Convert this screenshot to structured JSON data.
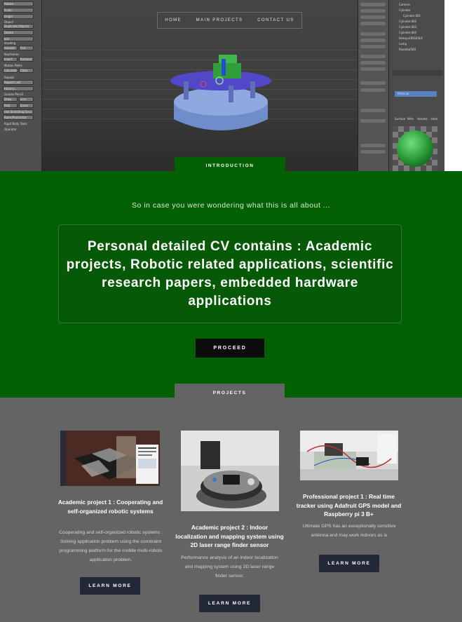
{
  "nav": {
    "items": [
      "HOME",
      "MAIN PROJECTS",
      "CONTACT US"
    ]
  },
  "hero": {
    "left_panel": [
      "Rotate",
      "Scale",
      "Origin",
      "Object",
      "Duplicate Objects",
      "Delete",
      "Join",
      "Shading",
      "Smooth",
      "Flat",
      "Keyframes",
      "Insert",
      "Remove",
      "Motion Paths",
      "Calculate",
      "Clear",
      "Repeat",
      "Repeat Last",
      "History...",
      "Grease Pencil",
      "Draw",
      "Line",
      "Poly",
      "Erase",
      "Use Sketching Sess",
      "Ruler/Protractor",
      "Rigid Body Tools",
      "Operator"
    ],
    "right_panel": [
      "Camera",
      "Cylinder",
      "Cylinder.001",
      "Cylinder.002",
      "Cylinder.003",
      "Cylinder.004",
      "HokuyoURG04LX",
      "Lamp",
      "Roomba560"
    ],
    "material_label": "Material",
    "material_tabs": [
      "Surface",
      "Wire",
      "Volume",
      "Halo"
    ]
  },
  "intro": {
    "tab_label": "INTRODUCTION",
    "subtitle": "So in case you were wondering what this is all about ...",
    "headline": "Personal detailed CV contains : Academic projects, Robotic related applications, scientific research papers, embedded hardware applications",
    "proceed_label": "PROCEED"
  },
  "projects": {
    "tab_label": "PROJECTS",
    "items": [
      {
        "title": "Academic project 1 : Cooperating and self-organized robotic systems",
        "description": "Cooperating and self-organized robotic systems : Solving application problem using the constraint programming platform for the mobile multi-robots application problem.",
        "button": "LEARN MORE"
      },
      {
        "title": "Academic project 2 : Indoor localization and mapping system using 2D laser range finder sensor",
        "description": "Performance analysis of an indoor localization and mapping system using 2D laser range finder sensor.",
        "button": "LEARN MORE"
      },
      {
        "title": "Professional project 1 : Real time tracker using Adafruit GPS model and Raspberry pi 3 B+",
        "description": "Ultimate GPS has an exceptionally sensitive antenna and may work indoors as is",
        "button": "LEARN MORE"
      }
    ]
  },
  "colors": {
    "intro_green": "#046103",
    "projects_gray": "#646464",
    "button_dark": "#232838",
    "proceed_black": "#0b0b0b"
  }
}
